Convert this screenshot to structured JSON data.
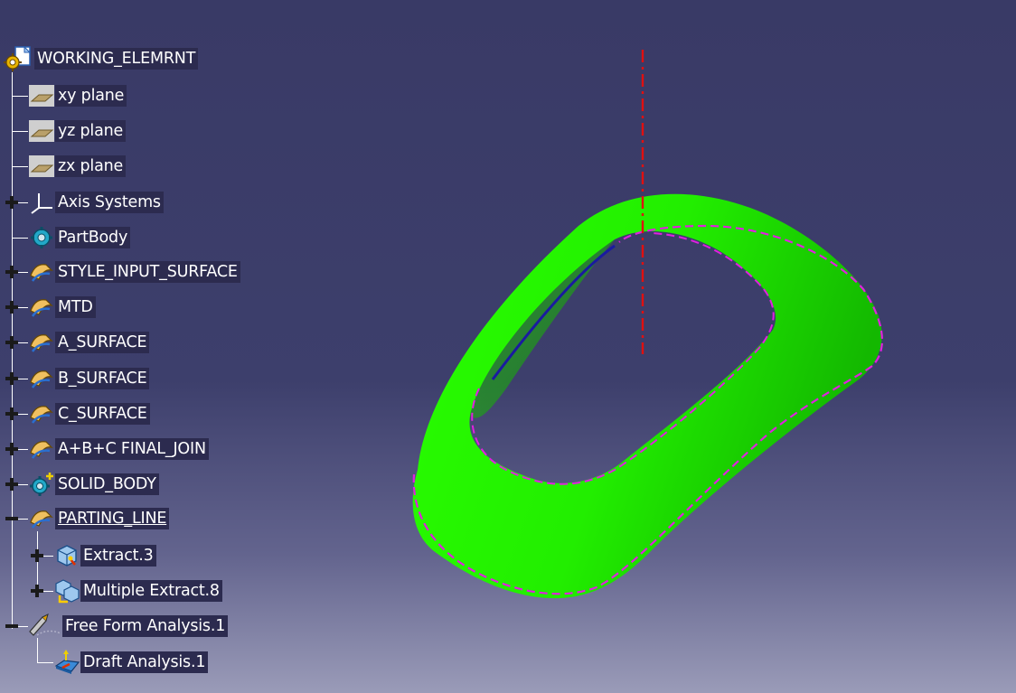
{
  "tree": {
    "root": {
      "label": "WORKING_ELEMRNT",
      "icon": "part-icon"
    },
    "items": [
      {
        "label": "xy plane",
        "icon": "plane-icon",
        "expander": "none"
      },
      {
        "label": "yz plane",
        "icon": "plane-icon",
        "expander": "none"
      },
      {
        "label": "zx plane",
        "icon": "plane-icon",
        "expander": "none"
      },
      {
        "label": "Axis Systems",
        "icon": "axis-system-icon",
        "expander": "plus"
      },
      {
        "label": "PartBody",
        "icon": "body-gear-icon",
        "expander": "none"
      },
      {
        "label": "STYLE_INPUT_SURFACE",
        "icon": "geometrical-set-icon",
        "expander": "plus"
      },
      {
        "label": "MTD",
        "icon": "geometrical-set-icon",
        "expander": "plus"
      },
      {
        "label": "A_SURFACE",
        "icon": "geometrical-set-icon",
        "expander": "plus"
      },
      {
        "label": "B_SURFACE",
        "icon": "geometrical-set-icon",
        "expander": "plus"
      },
      {
        "label": "C_SURFACE",
        "icon": "geometrical-set-icon",
        "expander": "plus"
      },
      {
        "label": "A+B+C FINAL_JOIN",
        "icon": "geometrical-set-icon",
        "expander": "plus"
      },
      {
        "label": "SOLID_BODY",
        "icon": "body-gear-plus-icon",
        "expander": "plus"
      },
      {
        "label": "PARTING_LINE",
        "icon": "geometrical-set-icon",
        "expander": "minus",
        "underlined": true
      },
      {
        "label": "Extract.3",
        "icon": "extract-icon",
        "expander": "plus"
      },
      {
        "label": "Multiple Extract.8",
        "icon": "multiple-extract-icon",
        "expander": "plus"
      },
      {
        "label": "Free Form Analysis.1",
        "icon": "free-form-analysis-icon",
        "expander": "minus"
      },
      {
        "label": "Draft Analysis.1",
        "icon": "draft-analysis-icon",
        "expander": "none"
      }
    ]
  },
  "colors": {
    "background_top": "#393a66",
    "background_bottom": "#9a9bb8",
    "part_surface": "#22ee00",
    "parting_line": "#e020e0",
    "axis_line": "#e01010",
    "tree_line": "#ffffff",
    "label_background": "#2c2b4f"
  }
}
